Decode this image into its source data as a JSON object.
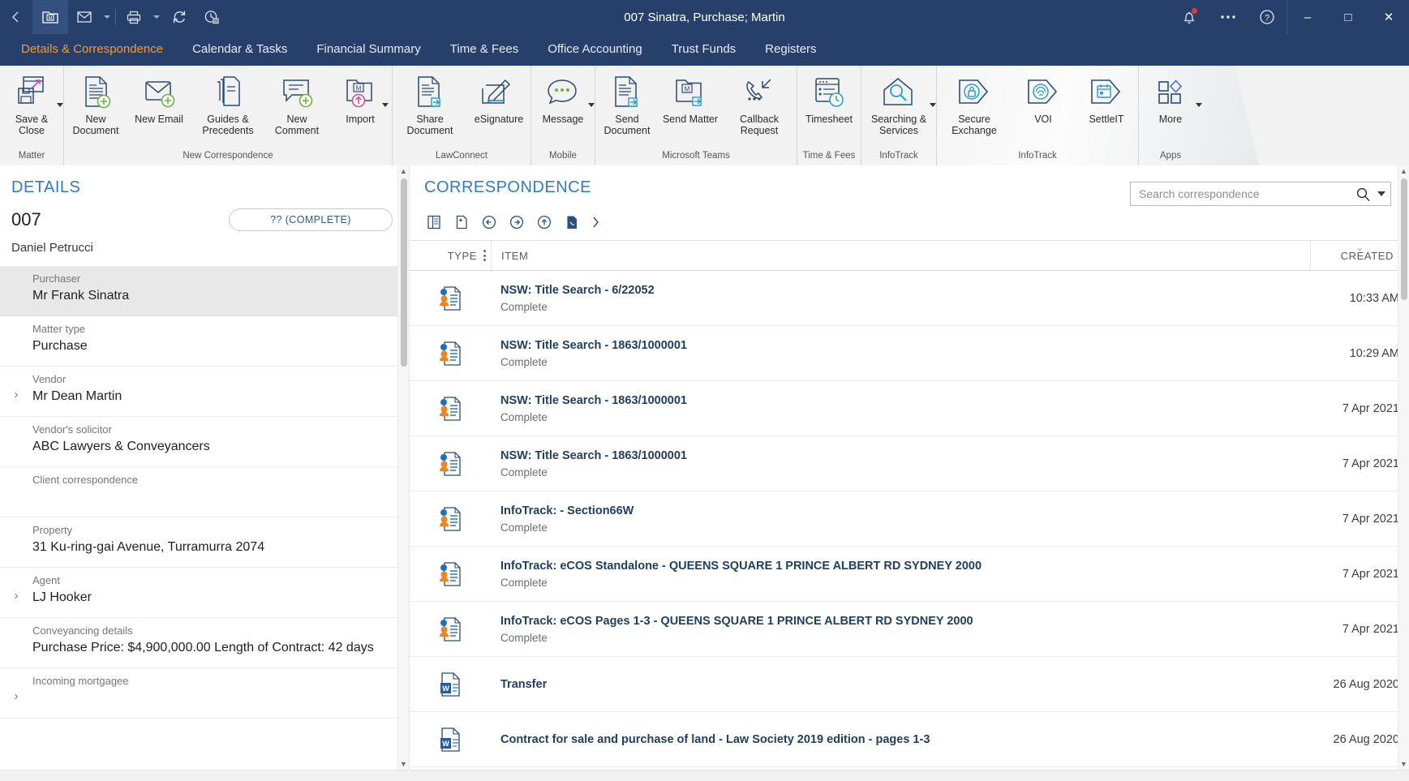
{
  "titlebar": {
    "title": "007 Sinatra, Purchase; Martin",
    "left_icons": [
      {
        "name": "back-arrow-icon",
        "label": "Back"
      },
      {
        "name": "matter-folder-icon",
        "label": "Matter"
      },
      {
        "name": "email-icon",
        "label": "Email"
      },
      {
        "name": "print-icon",
        "label": "Print"
      },
      {
        "name": "refresh-icon",
        "label": "Refresh"
      },
      {
        "name": "recent-history-icon",
        "label": "Recent"
      }
    ],
    "right_icons": [
      {
        "name": "notification-bell-icon",
        "label": "Notifications",
        "badge": true
      },
      {
        "name": "more-options-icon",
        "label": "More options"
      },
      {
        "name": "help-icon",
        "label": "Help"
      }
    ],
    "window_controls": {
      "minimize": "–",
      "maximize": "□",
      "close": "✕"
    }
  },
  "tabs": [
    {
      "label": "Details & Correspondence",
      "active": true
    },
    {
      "label": "Calendar & Tasks",
      "active": false
    },
    {
      "label": "Financial Summary",
      "active": false
    },
    {
      "label": "Time & Fees",
      "active": false
    },
    {
      "label": "Office Accounting",
      "active": false
    },
    {
      "label": "Trust Funds",
      "active": false
    },
    {
      "label": "Registers",
      "active": false
    }
  ],
  "ribbon": {
    "groups": [
      {
        "label": "Matter",
        "buttons": [
          {
            "label": "Save & Close",
            "icon": "save-close-icon",
            "caret": true
          }
        ]
      },
      {
        "label": "New Correspondence",
        "buttons": [
          {
            "label": "New Document",
            "icon": "new-document-icon",
            "caret": false
          },
          {
            "label": "New Email",
            "icon": "new-email-icon",
            "caret": false
          },
          {
            "label": "Guides & Precedents",
            "icon": "guides-precedents-icon",
            "caret": false
          },
          {
            "label": "New Comment",
            "icon": "new-comment-icon",
            "caret": false
          },
          {
            "label": "Import",
            "icon": "import-icon",
            "caret": true
          }
        ]
      },
      {
        "label": "LawConnect",
        "buttons": [
          {
            "label": "Share Document",
            "icon": "share-document-icon",
            "caret": false
          },
          {
            "label": "eSignature",
            "icon": "esignature-icon",
            "caret": false
          }
        ]
      },
      {
        "label": "Mobile",
        "buttons": [
          {
            "label": "Message",
            "icon": "message-icon",
            "caret": true
          }
        ]
      },
      {
        "label": "Microsoft Teams",
        "buttons": [
          {
            "label": "Send Document",
            "icon": "send-document-icon",
            "caret": false
          },
          {
            "label": "Send Matter",
            "icon": "send-matter-icon",
            "caret": false
          },
          {
            "label": "Callback Request",
            "icon": "callback-request-icon",
            "caret": false
          }
        ]
      },
      {
        "label": "Time & Fees",
        "buttons": [
          {
            "label": "Timesheet",
            "icon": "timesheet-icon",
            "caret": false
          }
        ]
      },
      {
        "label": "InfoTrack",
        "buttons": [
          {
            "label": "Searching & Services",
            "icon": "searching-services-icon",
            "caret": true
          }
        ]
      },
      {
        "label": "InfoTrack",
        "buttons": [
          {
            "label": "Secure Exchange",
            "icon": "secure-exchange-icon",
            "caret": false
          },
          {
            "label": "VOI",
            "icon": "voi-icon",
            "caret": false
          },
          {
            "label": "SettleIT",
            "icon": "settleit-icon",
            "caret": false
          }
        ]
      },
      {
        "label": "Apps",
        "buttons": [
          {
            "label": "More",
            "icon": "more-apps-icon",
            "caret": true
          }
        ]
      }
    ]
  },
  "details": {
    "heading": "DETAILS",
    "matter_number": "007",
    "status_pill": "?? (COMPLETE)",
    "owner": "Daniel Petrucci",
    "fields": [
      {
        "label": "Purchaser",
        "value": "Mr Frank Sinatra",
        "chevron": false,
        "highlight": true
      },
      {
        "label": "Matter type",
        "value": "Purchase",
        "chevron": false,
        "highlight": false
      },
      {
        "label": "Vendor",
        "value": "Mr Dean Martin",
        "chevron": true,
        "highlight": false
      },
      {
        "label": "Vendor's solicitor",
        "value": "ABC Lawyers & Conveyancers",
        "chevron": false,
        "highlight": false
      },
      {
        "label": "Client correspondence",
        "value": "",
        "chevron": false,
        "highlight": false
      },
      {
        "label": "Property",
        "value": "31 Ku-ring-gai Avenue, Turramurra 2074",
        "chevron": false,
        "highlight": false
      },
      {
        "label": "Agent",
        "value": "LJ Hooker",
        "chevron": true,
        "highlight": false
      },
      {
        "label": "Conveyancing details",
        "value": "Purchase Price: $4,900,000.00 Length of Contract: 42 days",
        "chevron": false,
        "highlight": false
      },
      {
        "label": "Incoming mortgagee",
        "value": "",
        "chevron": true,
        "highlight": false
      }
    ]
  },
  "correspondence": {
    "heading": "CORRESPONDENCE",
    "search": {
      "value": "",
      "placeholder": "Search correspondence"
    },
    "toolbar": [
      {
        "name": "split-view-icon",
        "label": "Split view"
      },
      {
        "name": "add-document-icon",
        "label": "Add document"
      },
      {
        "name": "previous-icon",
        "label": "Previous"
      },
      {
        "name": "next-icon",
        "label": "Next"
      },
      {
        "name": "upload-icon",
        "label": "Upload"
      },
      {
        "name": "pdf-document-icon",
        "label": "PDF"
      },
      {
        "name": "expand-toolbar-icon",
        "label": "More"
      }
    ],
    "columns": [
      "TYPE",
      "ITEM",
      "CREATED"
    ],
    "rows": [
      {
        "icon": "infotrack-search-icon",
        "title": "NSW: Title Search - 6/22052",
        "subtitle": "Complete",
        "created": "10:33 AM"
      },
      {
        "icon": "infotrack-search-icon",
        "title": "NSW: Title Search - 1863/1000001",
        "subtitle": "Complete",
        "created": "10:29 AM"
      },
      {
        "icon": "infotrack-search-icon",
        "title": "NSW: Title Search - 1863/1000001",
        "subtitle": "Complete",
        "created": "7 Apr 2021"
      },
      {
        "icon": "infotrack-search-icon",
        "title": "NSW: Title Search - 1863/1000001",
        "subtitle": "Complete",
        "created": "7 Apr 2021"
      },
      {
        "icon": "infotrack-search-icon",
        "title": "InfoTrack:  - Section66W",
        "subtitle": "Complete",
        "created": "7 Apr 2021"
      },
      {
        "icon": "infotrack-search-icon",
        "title": "InfoTrack: eCOS Standalone - QUEENS SQUARE 1 PRINCE ALBERT RD SYDNEY 2000",
        "subtitle": "Complete",
        "created": "7 Apr 2021"
      },
      {
        "icon": "infotrack-search-icon",
        "title": "InfoTrack: eCOS Pages 1-3 - QUEENS SQUARE 1 PRINCE ALBERT RD SYDNEY 2000",
        "subtitle": "Complete",
        "created": "7 Apr 2021"
      },
      {
        "icon": "word-document-icon",
        "title": "Transfer",
        "subtitle": "",
        "created": "26 Aug 2020"
      },
      {
        "icon": "word-document-icon",
        "title": "Contract for sale and purchase of land - Law Society 2019 edition - pages 1-3",
        "subtitle": "",
        "created": "26 Aug 2020"
      }
    ]
  },
  "colors": {
    "titlebar": "#27406b",
    "accent_orange": "#ef9a3c",
    "heading_blue": "#2f7cc4",
    "item_link": "#1f3f63"
  }
}
